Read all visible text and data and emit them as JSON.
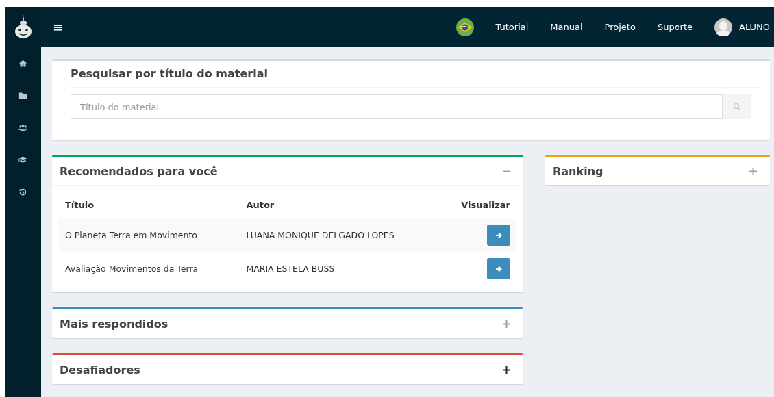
{
  "header": {
    "menu_icon": "≡",
    "nav": [
      "Tutorial",
      "Manual",
      "Projeto",
      "Suporte"
    ],
    "user": "ALUNO"
  },
  "search": {
    "title": "Pesquisar por título do material",
    "placeholder": "Título do material"
  },
  "left_boxes": [
    {
      "title": "Recomendados para você",
      "color": "#00a65a",
      "expanded": true,
      "toggle_dark": false,
      "table": {
        "columns": [
          "Título",
          "Autor",
          "Visualizar"
        ],
        "rows": [
          {
            "title": "O Planeta Terra em Movimento",
            "author": "LUANA MONIQUE DELGADO LOPES"
          },
          {
            "title": "Avaliação Movimentos da Terra",
            "author": "MARIA ESTELA BUSS"
          }
        ]
      }
    },
    {
      "title": "Mais respondidos",
      "color": "#3c8dbc",
      "expanded": false,
      "toggle_dark": false
    },
    {
      "title": "Desafiadores",
      "color": "#dd4b39",
      "expanded": false,
      "toggle_dark": true
    }
  ],
  "right_boxes": [
    {
      "title": "Ranking",
      "color": "#f39c12",
      "expanded": false,
      "toggle_dark": false
    }
  ]
}
